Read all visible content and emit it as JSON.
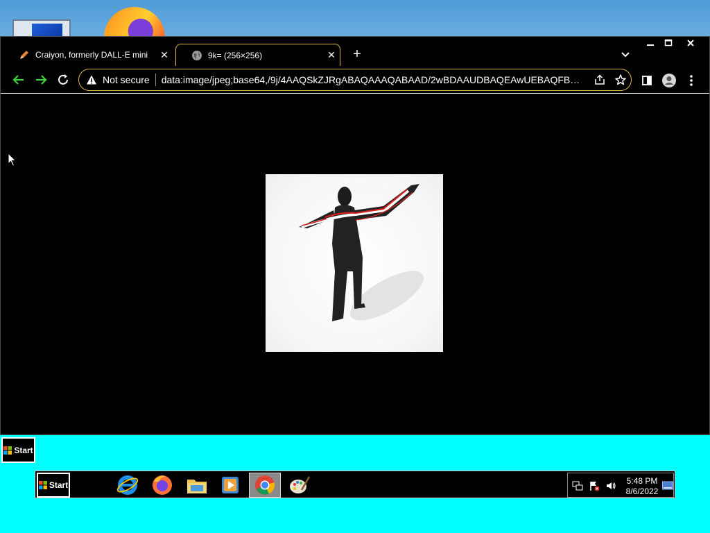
{
  "browser": {
    "tabs": [
      {
        "title": "Craiyon, formerly DALL-E mini",
        "icon": "pencil-icon",
        "active": false
      },
      {
        "title": "9k= (256×256)",
        "icon": "globe-icon",
        "active": true
      }
    ],
    "security_label": "Not secure",
    "url": "data:image/jpeg;base64,/9j/4AAQSkZJRgABAQAAAQABAAD/2wBDAAUDBAQEAwUEBAQFBQ...",
    "accent_color": "#d9b84a"
  },
  "taskbar": {
    "start_label_small": "Start",
    "start_label": "Start",
    "apps": [
      {
        "name": "internet-explorer-icon",
        "active": false
      },
      {
        "name": "firefox-icon",
        "active": false
      },
      {
        "name": "file-explorer-icon",
        "active": false
      },
      {
        "name": "media-player-icon",
        "active": false
      },
      {
        "name": "chrome-icon",
        "active": true
      },
      {
        "name": "paint-icon",
        "active": false
      }
    ],
    "clock_time": "5:48 PM",
    "clock_date": "8/6/2022"
  }
}
